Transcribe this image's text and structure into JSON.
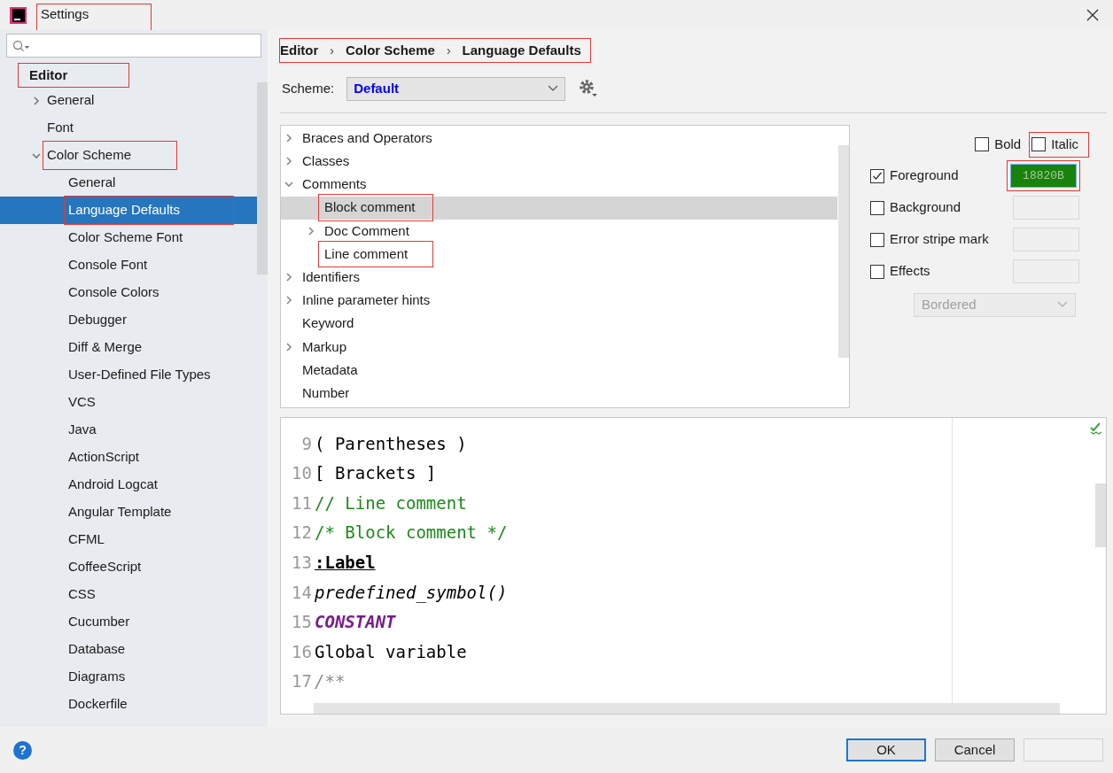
{
  "window": {
    "title": "Settings",
    "title_annotated": true
  },
  "sidebar": {
    "sections": [
      {
        "label": "Editor",
        "annotated": true,
        "items": [
          {
            "label": "General",
            "expanded": false,
            "selected": false,
            "annotated": false
          },
          {
            "label": "Font",
            "selected": false,
            "annotated": false
          },
          {
            "label": "Color Scheme",
            "expanded": true,
            "selected": false,
            "annotated": true,
            "children": [
              {
                "label": "General",
                "selected": false,
                "annotated": false
              },
              {
                "label": "Language Defaults",
                "selected": true,
                "annotated": true
              },
              {
                "label": "Color Scheme Font",
                "selected": false,
                "annotated": false
              },
              {
                "label": "Console Font",
                "selected": false,
                "annotated": false
              },
              {
                "label": "Console Colors",
                "selected": false,
                "annotated": false
              },
              {
                "label": "Debugger",
                "selected": false,
                "annotated": false
              },
              {
                "label": "Diff & Merge",
                "selected": false,
                "annotated": false
              },
              {
                "label": "User-Defined File Types",
                "selected": false,
                "annotated": false
              },
              {
                "label": "VCS",
                "selected": false,
                "annotated": false
              },
              {
                "label": "Java",
                "selected": false,
                "annotated": false
              },
              {
                "label": "ActionScript",
                "selected": false,
                "annotated": false
              },
              {
                "label": "Android Logcat",
                "selected": false,
                "annotated": false
              },
              {
                "label": "Angular Template",
                "selected": false,
                "annotated": false
              },
              {
                "label": "CFML",
                "selected": false,
                "annotated": false
              },
              {
                "label": "CoffeeScript",
                "selected": false,
                "annotated": false
              },
              {
                "label": "CSS",
                "selected": false,
                "annotated": false
              },
              {
                "label": "Cucumber",
                "selected": false,
                "annotated": false
              },
              {
                "label": "Database",
                "selected": false,
                "annotated": false
              },
              {
                "label": "Diagrams",
                "selected": false,
                "annotated": false
              },
              {
                "label": "Dockerfile",
                "selected": false,
                "annotated": false
              }
            ]
          }
        ]
      }
    ]
  },
  "breadcrumb": {
    "annotated": true,
    "separator": "›",
    "items": [
      "Editor",
      "Color Scheme",
      "Language Defaults"
    ]
  },
  "scheme": {
    "label": "Scheme:",
    "value": "Default"
  },
  "tree": [
    {
      "label": "Braces and Operators",
      "expanded": false,
      "selected": false,
      "annotated": false
    },
    {
      "label": "Classes",
      "expanded": false,
      "selected": false,
      "annotated": false
    },
    {
      "label": "Comments",
      "expanded": true,
      "selected": false,
      "annotated": false,
      "children": [
        {
          "label": "Block comment",
          "selected": true,
          "annotated": true
        },
        {
          "label": "Doc Comment",
          "expanded": false,
          "selected": false,
          "annotated": false
        },
        {
          "label": "Line comment",
          "selected": false,
          "annotated": true
        }
      ]
    },
    {
      "label": "Identifiers",
      "expanded": false,
      "selected": false,
      "annotated": false
    },
    {
      "label": "Inline parameter hints",
      "expanded": false,
      "selected": false,
      "annotated": false
    },
    {
      "label": "Keyword",
      "selected": false,
      "annotated": false
    },
    {
      "label": "Markup",
      "expanded": false,
      "selected": false,
      "annotated": false
    },
    {
      "label": "Metadata",
      "selected": false,
      "annotated": false
    },
    {
      "label": "Number",
      "selected": false,
      "annotated": false
    }
  ],
  "font_style": [
    {
      "label": "Bold",
      "checked": false,
      "annotated": false
    },
    {
      "label": "Italic",
      "checked": false,
      "annotated": true
    }
  ],
  "attributes": [
    {
      "label": "Foreground",
      "checked": true,
      "color": "#18820b",
      "value": "18820B",
      "annotated": true
    },
    {
      "label": "Background",
      "checked": false,
      "annotated": false
    },
    {
      "label": "Error stripe mark",
      "checked": false,
      "annotated": false
    },
    {
      "label": "Effects",
      "checked": false,
      "annotated": false
    }
  ],
  "effects_dropdown": {
    "value": "Bordered",
    "disabled": true
  },
  "preview": {
    "lines": [
      {
        "number": "9",
        "text": "( Parentheses )",
        "kind": "plain"
      },
      {
        "number": "10",
        "text": "[ Brackets ]",
        "kind": "plain"
      },
      {
        "number": "11",
        "text": "// Line comment",
        "kind": "comment"
      },
      {
        "number": "12",
        "text": "/* Block comment */",
        "kind": "comment"
      },
      {
        "number": "13",
        "text": ":Label",
        "kind": "label"
      },
      {
        "number": "14",
        "text": "predefined_symbol()",
        "kind": "italic"
      },
      {
        "number": "15",
        "text": "CONSTANT",
        "kind": "constant"
      },
      {
        "number": "16",
        "text": "Global variable",
        "kind": "plain"
      },
      {
        "number": "17",
        "text": "/**",
        "kind": "doc"
      }
    ]
  },
  "buttons": [
    {
      "label": "OK",
      "default": true,
      "disabled": false
    },
    {
      "label": "Cancel",
      "default": false,
      "disabled": false
    },
    {
      "disabled": true
    }
  ],
  "help": {
    "label": "?"
  }
}
